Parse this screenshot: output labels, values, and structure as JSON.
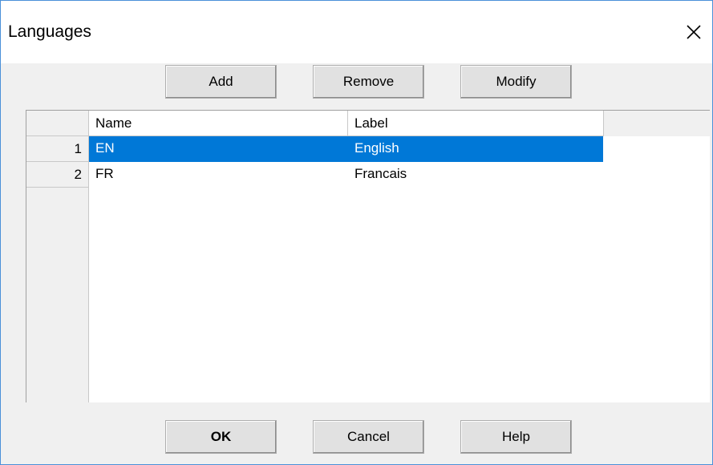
{
  "window": {
    "title": "Languages"
  },
  "icons": {
    "close": "close-icon"
  },
  "toolbar": {
    "add_label": "Add",
    "remove_label": "Remove",
    "modify_label": "Modify"
  },
  "grid": {
    "columns": [
      "Name",
      "Label"
    ],
    "rows": [
      {
        "num": "1",
        "name": "EN",
        "label": "English",
        "selected": true
      },
      {
        "num": "2",
        "name": "FR",
        "label": "Francais",
        "selected": false
      }
    ]
  },
  "colors": {
    "selection": "#0078d7",
    "dialog_border": "#4a90d9"
  },
  "footer": {
    "ok_label": "OK",
    "cancel_label": "Cancel",
    "help_label": "Help"
  }
}
